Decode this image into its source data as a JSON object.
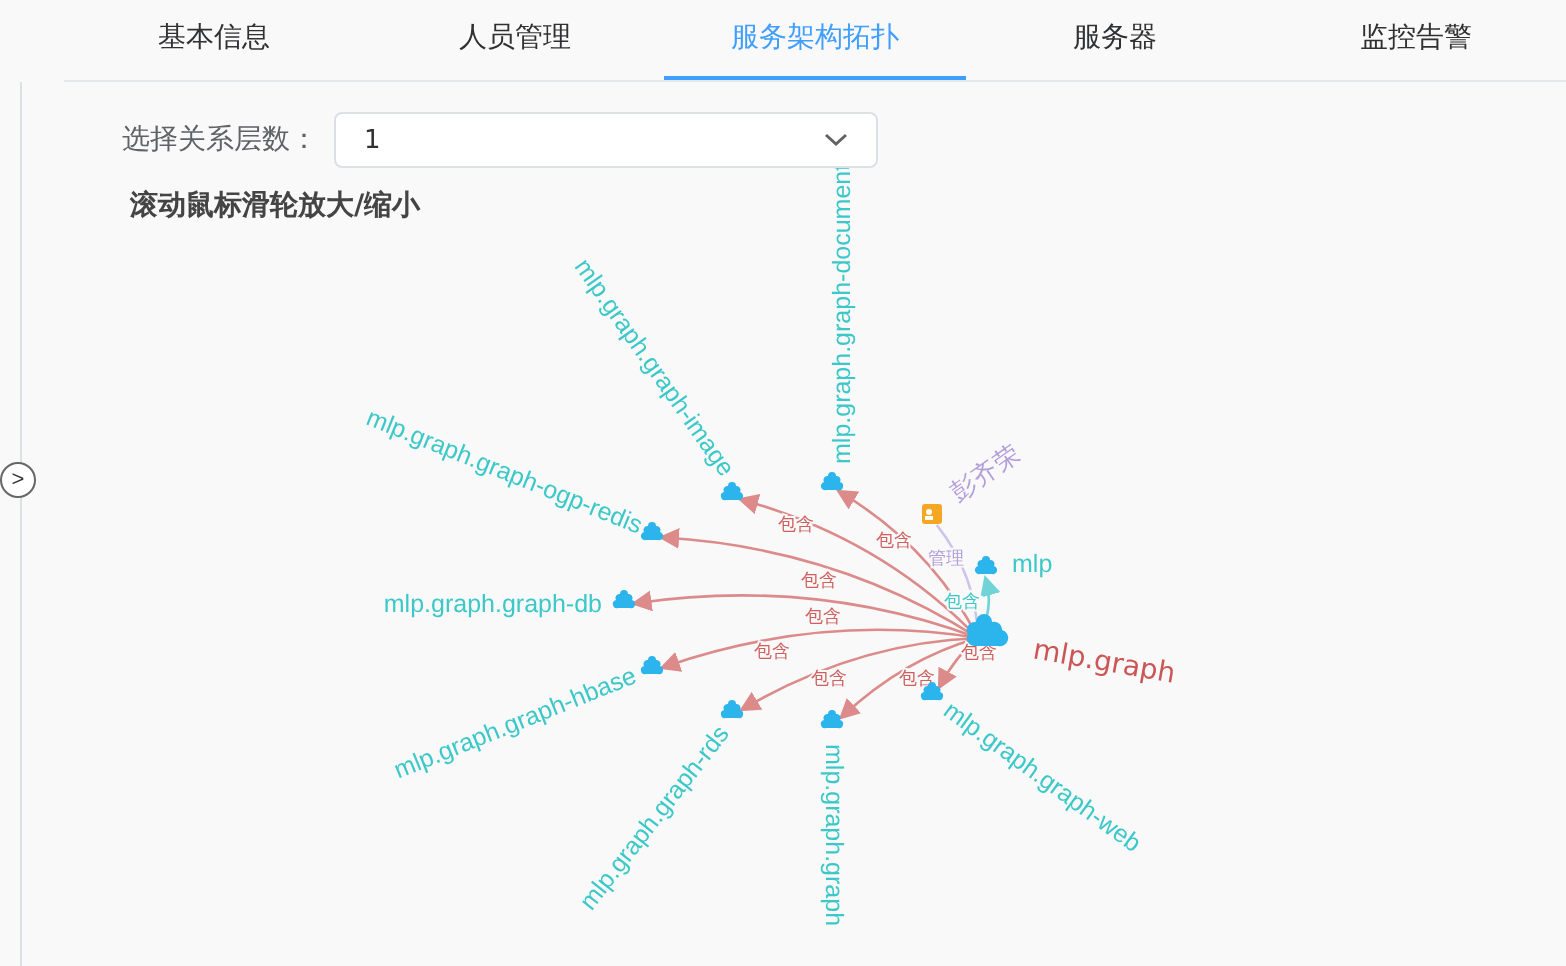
{
  "tabs": [
    {
      "label": "基本信息",
      "selected": false
    },
    {
      "label": "人员管理",
      "selected": false
    },
    {
      "label": "服务架构拓扑",
      "selected": true
    },
    {
      "label": "服务器",
      "selected": false
    },
    {
      "label": "监控告警",
      "selected": false
    }
  ],
  "sidebar_toggle": ">",
  "level_select": {
    "label": "选择关系层数：",
    "value": "1"
  },
  "hint": "滚动鼠标滑轮放大/缩小",
  "graph": {
    "center": {
      "label": "mlp.graph"
    },
    "nodes": [
      {
        "kind": "service",
        "label": "mlp.graph.graph-document",
        "edge_label": "包含"
      },
      {
        "kind": "service",
        "label": "mlp.graph.graph-image",
        "edge_label": "包含"
      },
      {
        "kind": "service",
        "label": "mlp.graph.graph-ogp-redis",
        "edge_label": "包含"
      },
      {
        "kind": "service",
        "label": "mlp.graph.graph-db",
        "edge_label": "包含"
      },
      {
        "kind": "service",
        "label": "mlp.graph.graph-hbase",
        "edge_label": "包含"
      },
      {
        "kind": "service",
        "label": "mlp.graph.graph-rds",
        "edge_label": "包含"
      },
      {
        "kind": "service",
        "label": "mlp.graph.graph",
        "edge_label": "包含"
      },
      {
        "kind": "service",
        "label": "mlp.graph.graph-web",
        "edge_label": "包含"
      },
      {
        "kind": "parent",
        "label": "mlp",
        "edge_label": "包含"
      },
      {
        "kind": "person",
        "label": "彭齐荣",
        "edge_label": "管理"
      }
    ]
  }
}
